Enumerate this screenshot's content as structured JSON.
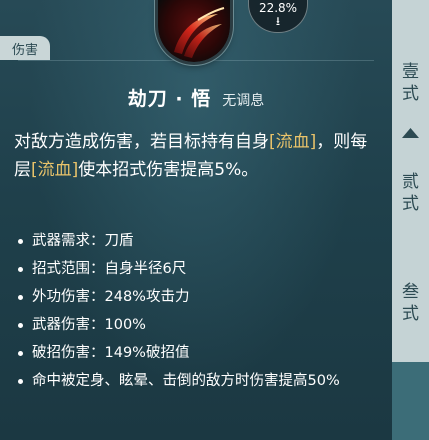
{
  "tag": "伤害",
  "progress": {
    "percent_text": "22.8%",
    "download_glyph": "⭳",
    "value": 0.228
  },
  "skill": {
    "name": "劫刀·悟",
    "name_parts": [
      "劫刀",
      "·",
      "悟"
    ],
    "subtitle": "无调息"
  },
  "description": {
    "part1": "对敌方造成伤害，若目标持有自身",
    "bleed": "[流血]",
    "part2": "，则每层",
    "part3": "使本招式伤害提高5%。"
  },
  "stats": [
    "武器需求：刀盾",
    "招式范围：自身半径6尺",
    "外功伤害：248%攻击力",
    "武器伤害：100%",
    "破招伤害：149%破招值",
    "命中被定身、眩晕、击倒的敌方时伤害提高50%"
  ],
  "sidebar": {
    "tab1": [
      "壹",
      "式"
    ],
    "tab2": [
      "贰",
      "式"
    ],
    "tab3": [
      "叁",
      "式"
    ]
  },
  "colors": {
    "panel_bg": "#234450",
    "highlight": "#e9c36a",
    "sidebar_bg": "#c5d3d5",
    "tag_bg": "#c9d6d7"
  },
  "icons": {
    "skill": "blade-slash-icon",
    "download": "download-icon",
    "bullet": "bullet-dot-icon"
  }
}
